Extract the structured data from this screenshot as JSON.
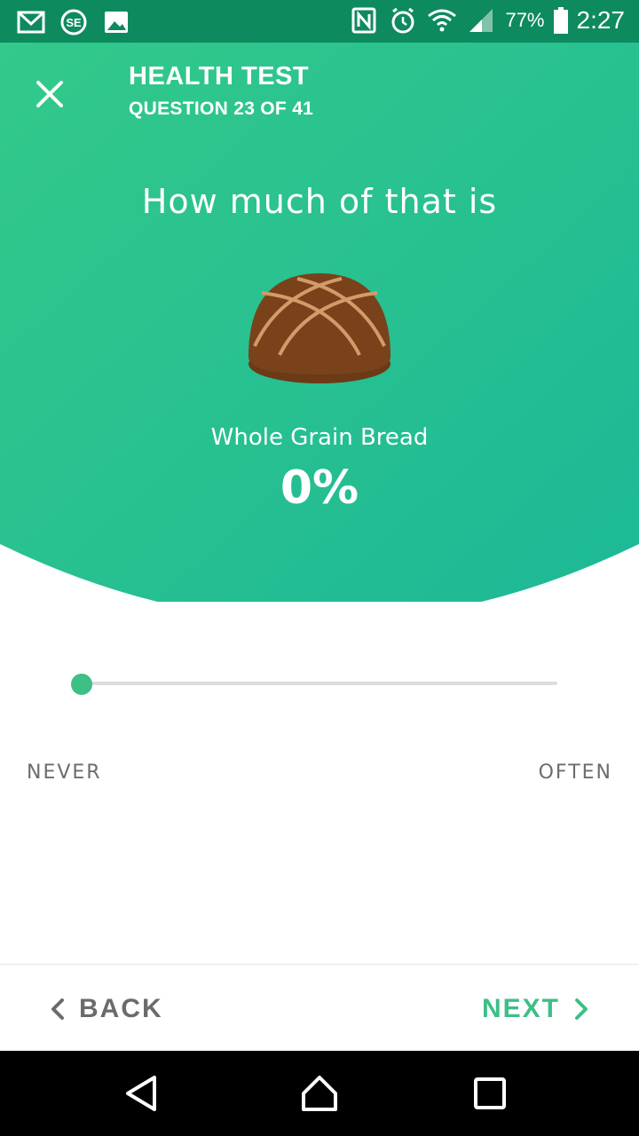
{
  "status_bar": {
    "battery_percent": "77%",
    "time": "2:27"
  },
  "header": {
    "title": "HEALTH TEST",
    "subtitle": "QUESTION 23 OF 41"
  },
  "question": {
    "text": "How much of that is",
    "food_name": "Whole Grain Bread",
    "value_percent": "0%"
  },
  "slider": {
    "value": 0,
    "min_label": "NEVER",
    "max_label": "OFTEN"
  },
  "footer": {
    "back_label": "BACK",
    "next_label": "NEXT"
  },
  "colors": {
    "accent": "#3dbf86",
    "header_gradient_start": "#33c98a",
    "header_gradient_end": "#1cb897"
  }
}
